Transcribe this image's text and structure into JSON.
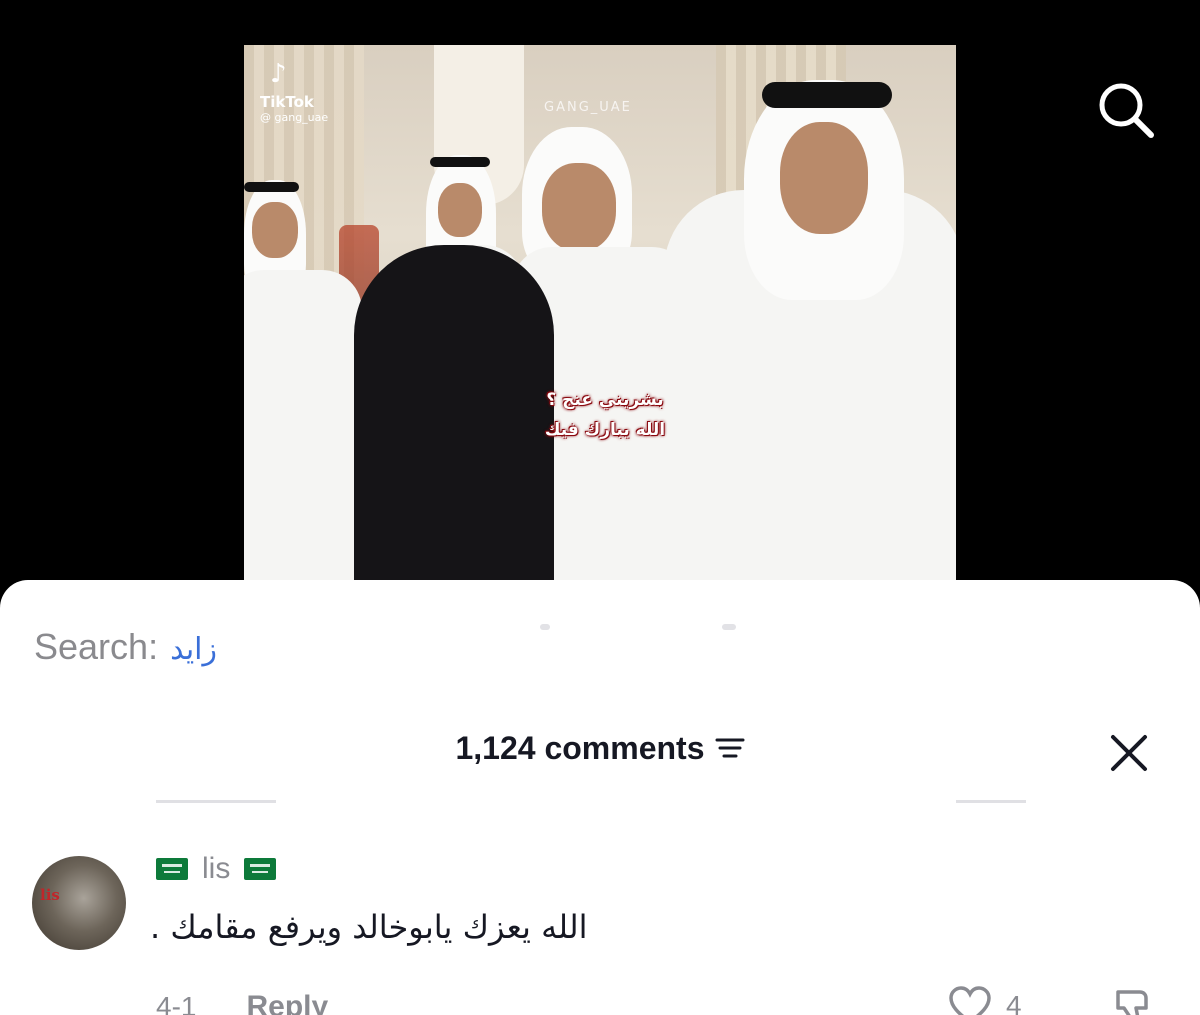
{
  "video": {
    "brand": "TikTok",
    "handle": "@ gang_uae",
    "watermark": "GANG_UAE",
    "caption_line1": "بشريني عنج ؟",
    "caption_line2": "الله يبارك فيك"
  },
  "search": {
    "label": "Search:",
    "query": "زايد"
  },
  "comments_header": {
    "count_label": "1,124 comments"
  },
  "comment": {
    "avatar_tag": "lis",
    "username": "lis",
    "text": "الله يعزك يابوخالد ويرفع مقامك .",
    "date": "4-1",
    "reply_label": "Reply",
    "like_count": "4"
  },
  "colors": {
    "accent_link": "#3a6fd8",
    "flag_green": "#0d7a3a",
    "caption_outline": "#8a0a10"
  },
  "icons": [
    "tiktok-icon",
    "search-icon",
    "sort-icon",
    "close-icon",
    "saudi-flag-icon",
    "heart-icon",
    "dislike-icon"
  ]
}
